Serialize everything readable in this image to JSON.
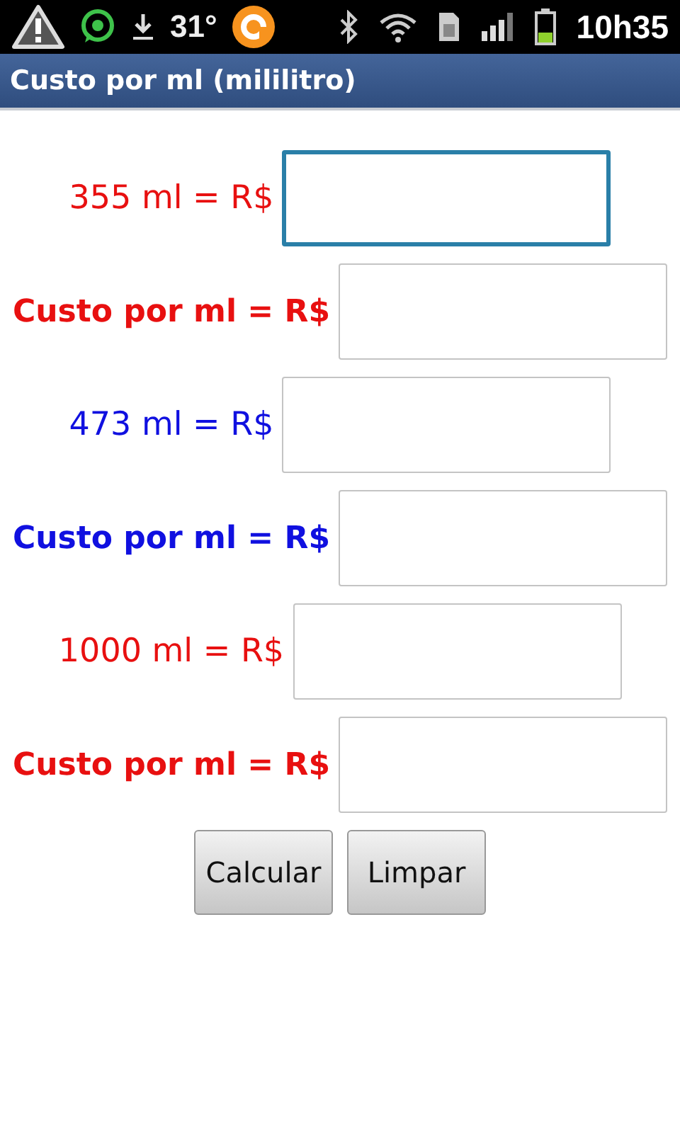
{
  "status_bar": {
    "temperature": "31°",
    "time": "10h35"
  },
  "title_bar": {
    "title": "Custo por ml (mililitro)"
  },
  "rows": [
    {
      "kind": "price",
      "label": "355 ml = R$",
      "color": "#e81010",
      "focused": true
    },
    {
      "kind": "result",
      "label": "Custo por ml = R$",
      "color": "#e81010",
      "focused": false
    },
    {
      "kind": "price",
      "label": "473 ml = R$",
      "color": "#1010e0",
      "focused": false
    },
    {
      "kind": "result",
      "label": "Custo por ml = R$",
      "color": "#1010e0",
      "focused": false
    },
    {
      "kind": "price",
      "label": "1000 ml = R$",
      "color": "#e81010",
      "focused": false
    },
    {
      "kind": "result",
      "label": "Custo por ml = R$",
      "color": "#e81010",
      "focused": false
    }
  ],
  "buttons": [
    "Calcular",
    "Limpar"
  ]
}
